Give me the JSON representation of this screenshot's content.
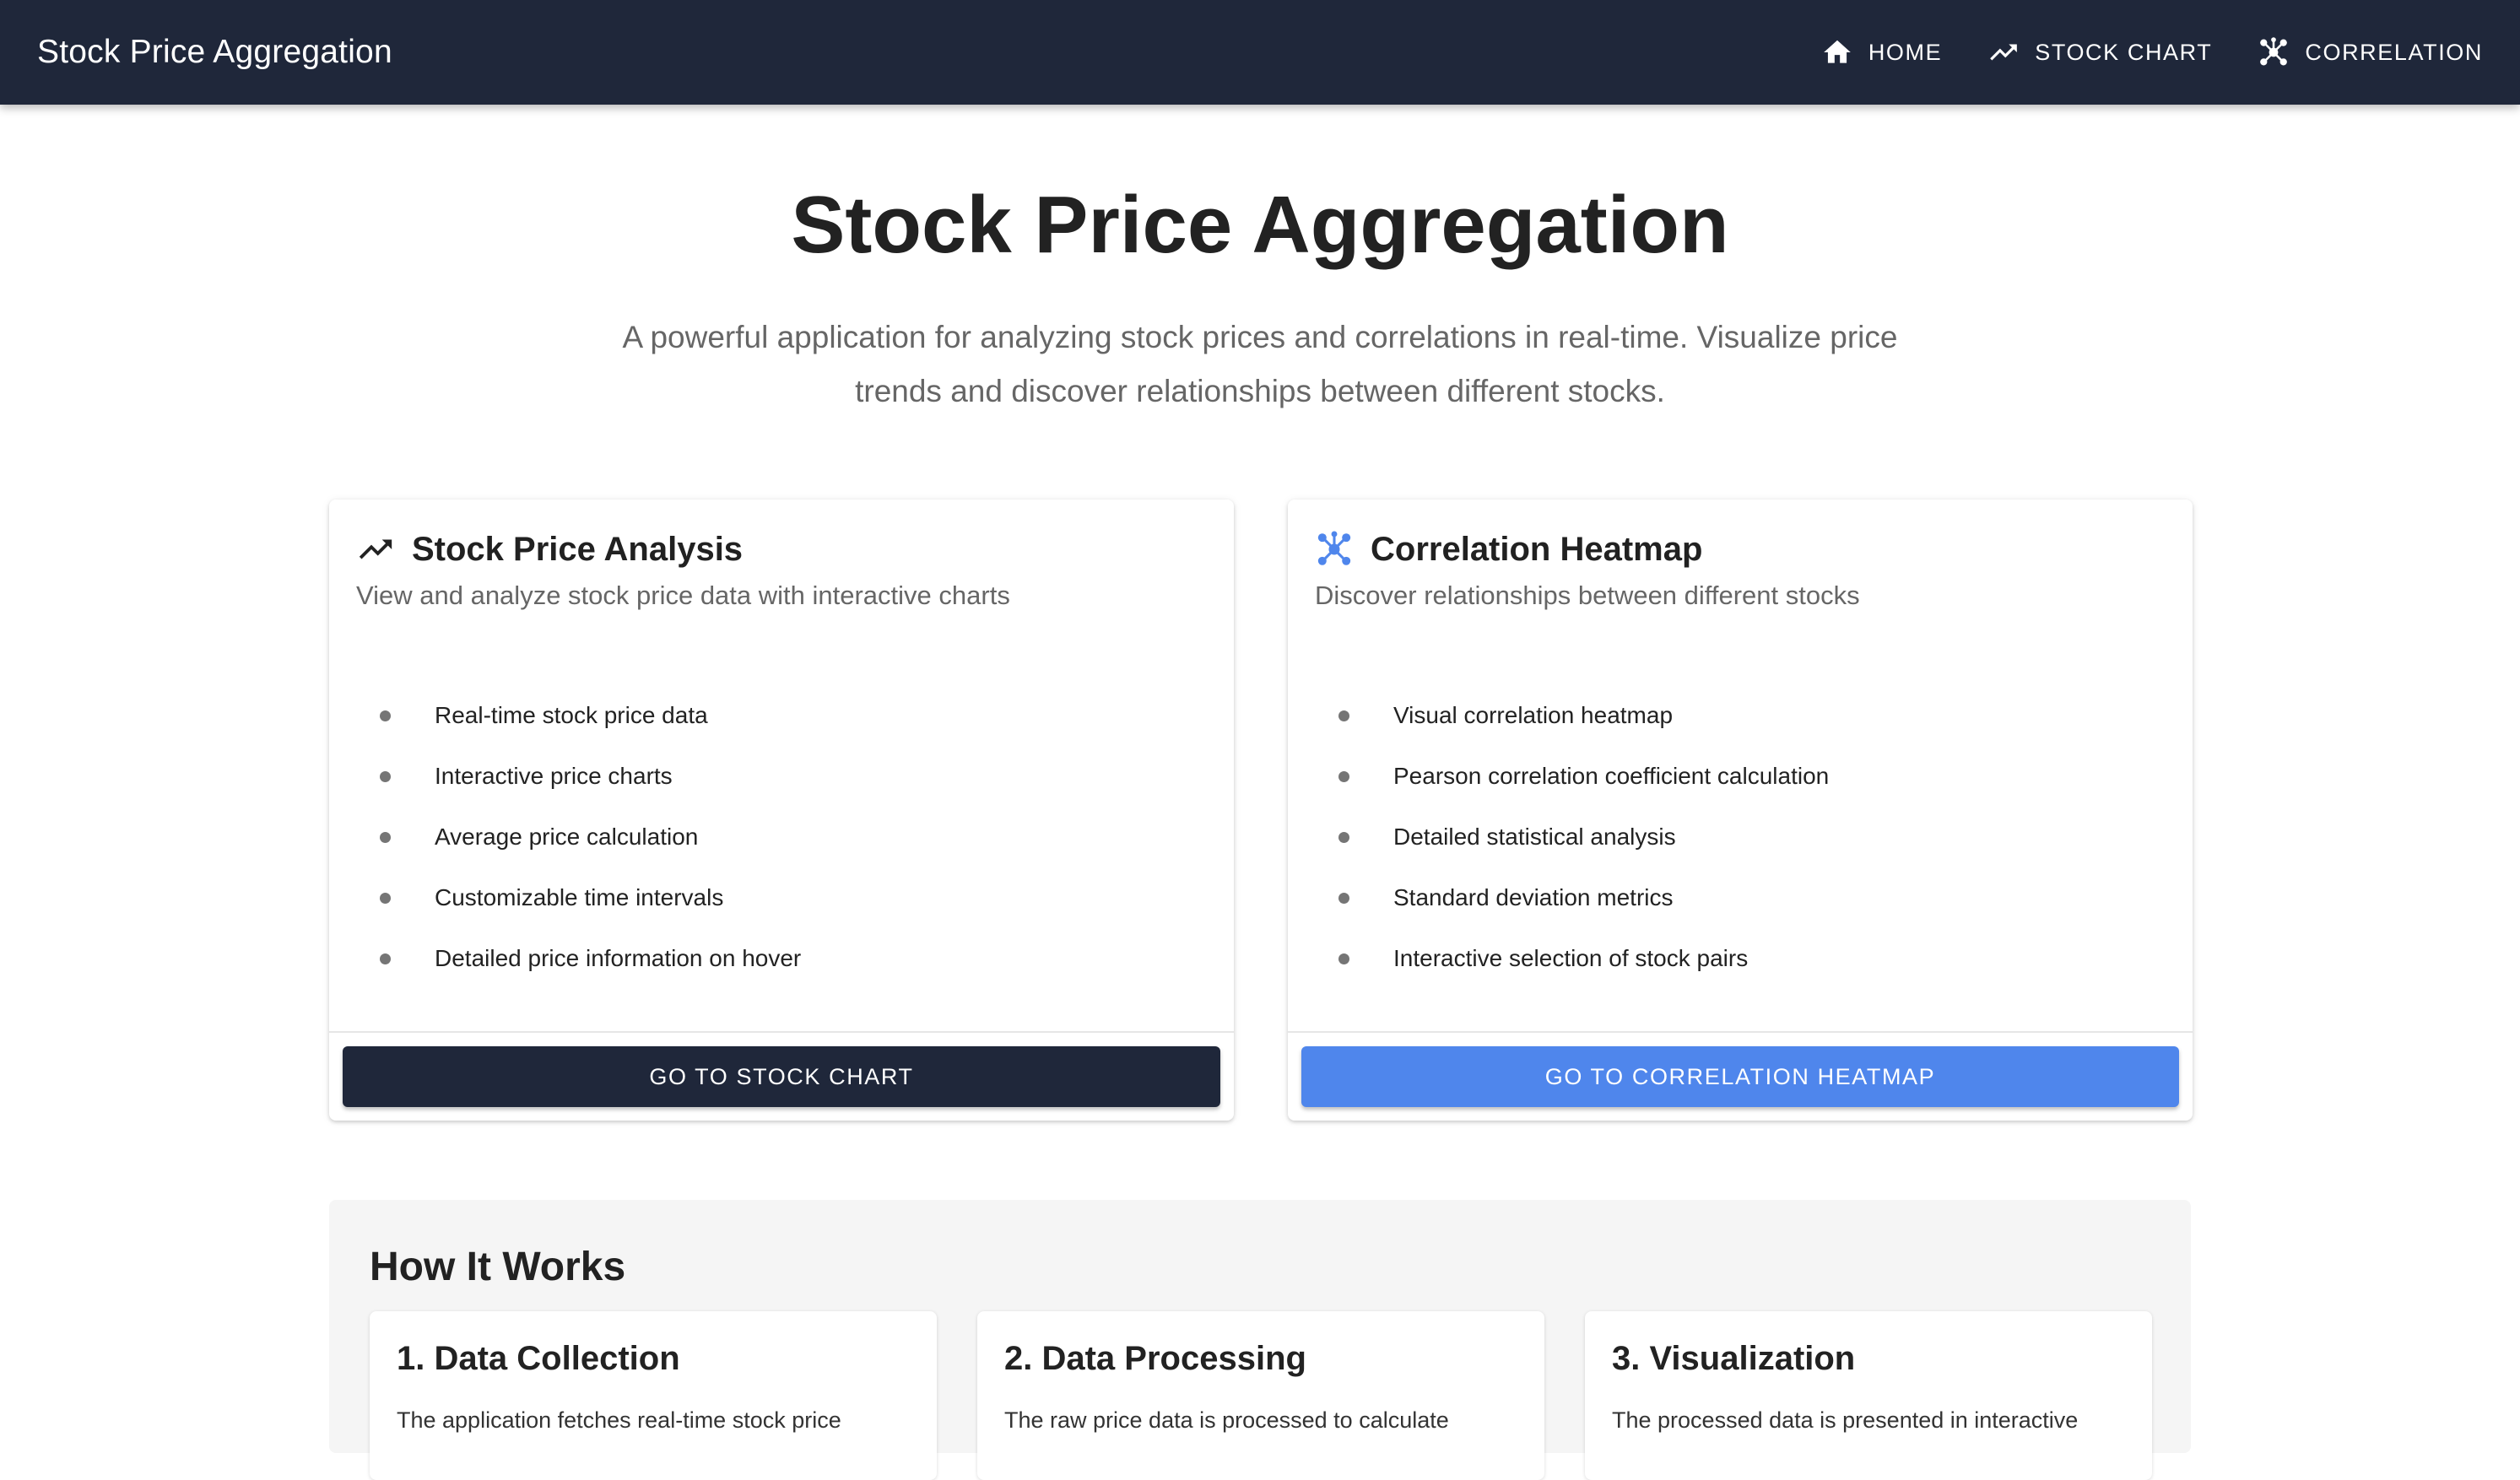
{
  "appbar": {
    "title": "Stock Price Aggregation",
    "nav": [
      {
        "label": "HOME",
        "icon": "home-icon"
      },
      {
        "label": "STOCK CHART",
        "icon": "trending-up-icon"
      },
      {
        "label": "CORRELATION",
        "icon": "bubble-chart-icon"
      }
    ]
  },
  "hero": {
    "title": "Stock Price Aggregation",
    "subtitle": "A powerful application for analyzing stock prices and correlations in real-time. Visualize price trends and discover relationships between different stocks."
  },
  "cards": [
    {
      "title": "Stock Price Analysis",
      "icon": "trending-up-icon",
      "icon_color": "#222222",
      "description": "View and analyze stock price data with interactive charts",
      "features": [
        "Real-time stock price data",
        "Interactive price charts",
        "Average price calculation",
        "Customizable time intervals",
        "Detailed price information on hover"
      ],
      "button": "GO TO STOCK CHART",
      "button_color": "#1f273a"
    },
    {
      "title": "Correlation Heatmap",
      "icon": "bubble-chart-icon",
      "icon_color": "#4f86ec",
      "description": "Discover relationships between different stocks",
      "features": [
        "Visual correlation heatmap",
        "Pearson correlation coefficient calculation",
        "Detailed statistical analysis",
        "Standard deviation metrics",
        "Interactive selection of stock pairs"
      ],
      "button": "GO TO CORRELATION HEATMAP",
      "button_color": "#4f86ec"
    }
  ],
  "how": {
    "title": "How It Works",
    "steps": [
      {
        "title": "1. Data Collection",
        "text": "The application fetches real-time stock price"
      },
      {
        "title": "2. Data Processing",
        "text": "The raw price data is processed to calculate"
      },
      {
        "title": "3. Visualization",
        "text": "The processed data is presented in interactive"
      }
    ]
  },
  "colors": {
    "appbar_bg": "#1f273a",
    "accent_blue": "#4f86ec"
  }
}
